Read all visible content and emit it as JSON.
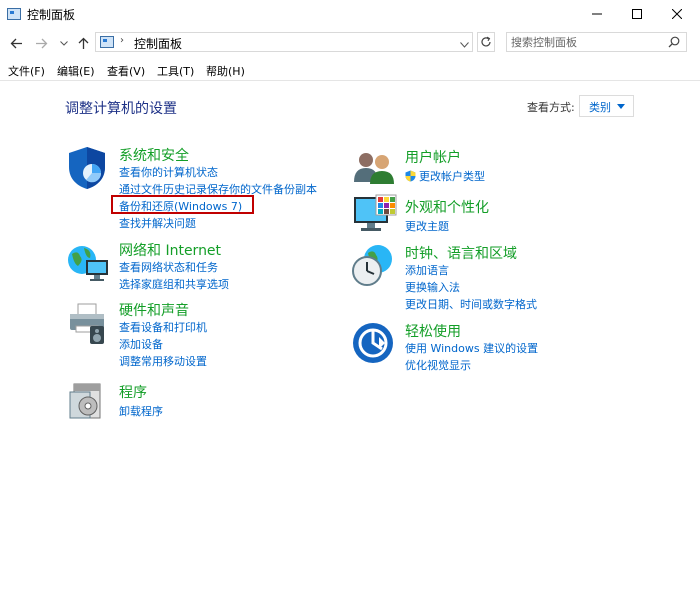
{
  "window": {
    "title": "控制面板"
  },
  "address_bar": {
    "location": "控制面板"
  },
  "search": {
    "placeholder": "搜索控制面板"
  },
  "menu": [
    "文件(F)",
    "编辑(E)",
    "查看(V)",
    "工具(T)",
    "帮助(H)"
  ],
  "page_title": "调整计算机的设置",
  "view_by": {
    "label": "查看方式:",
    "value": "类别"
  },
  "left_categories": [
    {
      "title": "系统和安全",
      "icon": "shield-icon",
      "links": [
        "查看你的计算机状态",
        "通过文件历史记录保存你的文件备份副本",
        "备份和还原(Windows 7)",
        "查找并解决问题"
      ]
    },
    {
      "title": "网络和 Internet",
      "icon": "network-globe-icon",
      "links": [
        "查看网络状态和任务",
        "选择家庭组和共享选项"
      ]
    },
    {
      "title": "硬件和声音",
      "icon": "printer-icon",
      "links": [
        "查看设备和打印机",
        "添加设备",
        "调整常用移动设置"
      ]
    },
    {
      "title": "程序",
      "icon": "programs-icon",
      "links": [
        "卸载程序"
      ]
    }
  ],
  "right_categories": [
    {
      "title": "用户帐户",
      "icon": "users-icon",
      "links": [
        "更改帐户类型"
      ]
    },
    {
      "title": "外观和个性化",
      "icon": "monitor-palette-icon",
      "links": [
        "更改主题"
      ]
    },
    {
      "title": "时钟、语言和区域",
      "icon": "clock-globe-icon",
      "links": [
        "添加语言",
        "更换输入法",
        "更改日期、时间或数字格式"
      ]
    },
    {
      "title": "轻松使用",
      "icon": "ease-of-access-icon",
      "links": [
        "使用 Windows 建议的设置",
        "优化视觉显示"
      ]
    }
  ],
  "highlighted_link": "备份和还原(Windows 7)",
  "colors": {
    "category_title": "#139e27",
    "link": "#0066cc",
    "page_title": "#1e3287",
    "highlight": "#c00000"
  }
}
